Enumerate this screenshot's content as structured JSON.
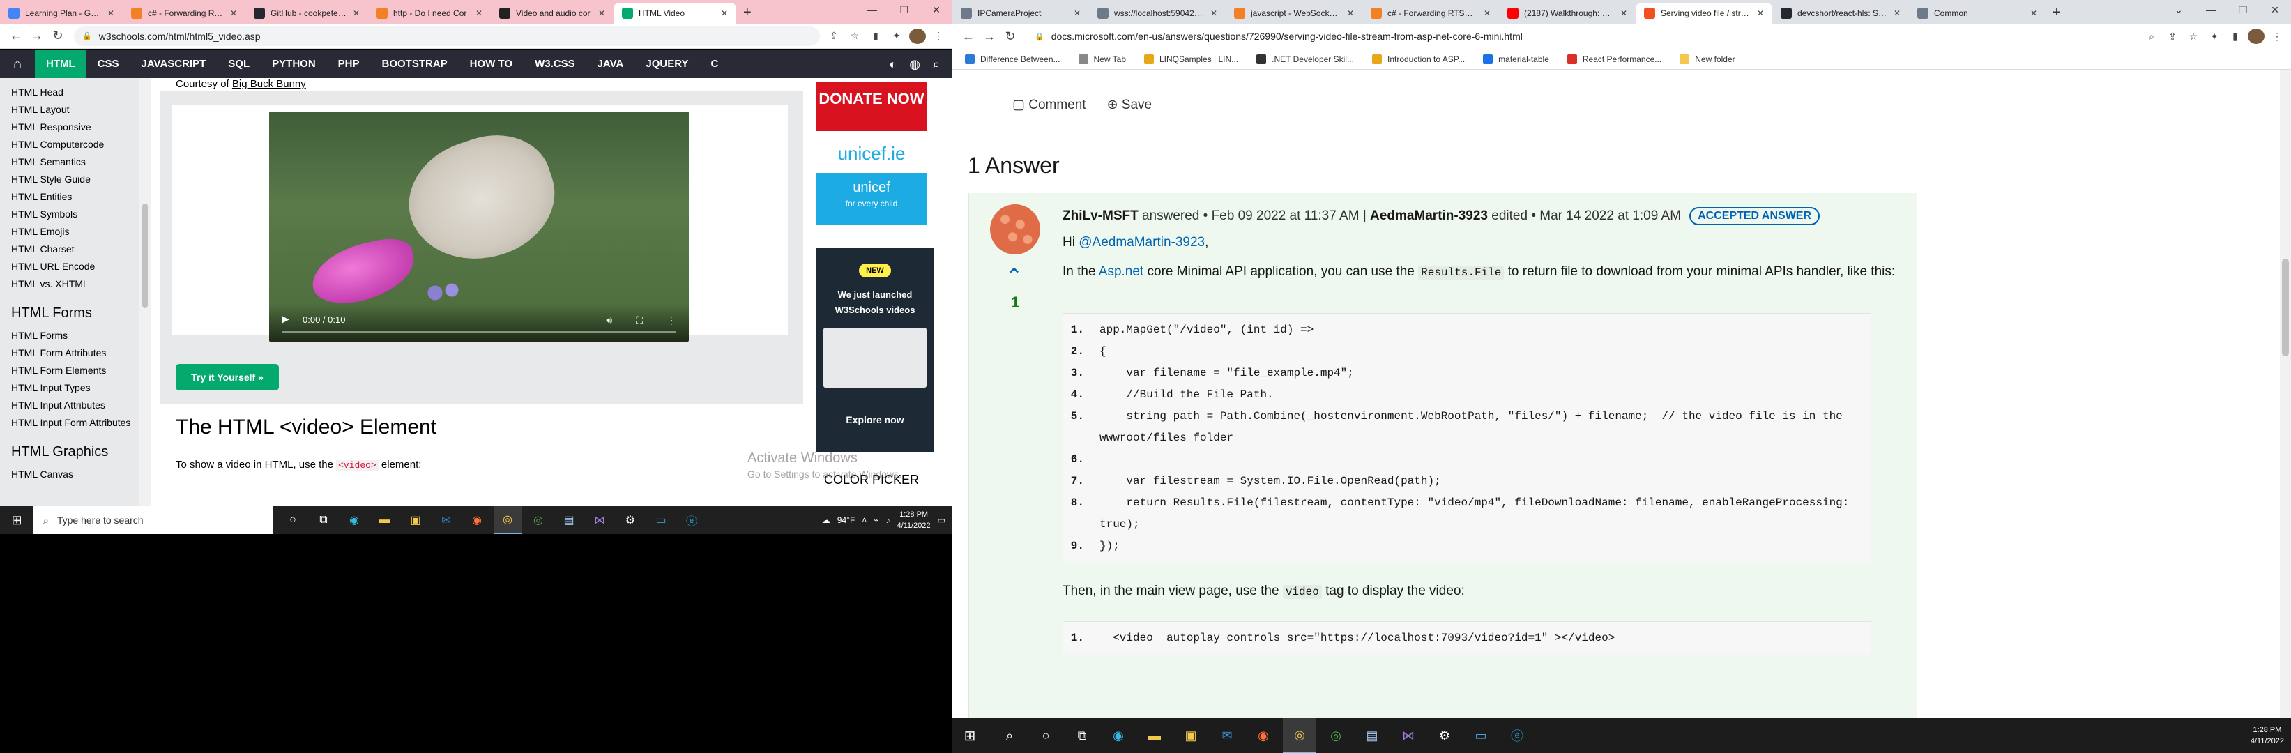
{
  "left": {
    "tabs": [
      {
        "title": "Learning Plan - Goog",
        "color": "#4285f4"
      },
      {
        "title": "c# - Forwarding RTSP",
        "color": "#f48024"
      },
      {
        "title": "GitHub - cookpete/re",
        "color": "#24292f"
      },
      {
        "title": "http - Do I need Cor",
        "color": "#f48024"
      },
      {
        "title": "Video and audio cor",
        "color": "#222222"
      },
      {
        "title": "HTML Video",
        "color": "#04aa6d"
      }
    ],
    "url": "w3schools.com/html/html5_video.asp",
    "nav": {
      "home_icon": "home-icon",
      "items": [
        "HTML",
        "CSS",
        "JAVASCRIPT",
        "SQL",
        "PYTHON",
        "PHP",
        "BOOTSTRAP",
        "HOW TO",
        "W3.CSS",
        "JAVA",
        "JQUERY",
        "C"
      ]
    },
    "sidebar": {
      "links1": [
        "HTML Head",
        "HTML Layout",
        "HTML Responsive",
        "HTML Computercode",
        "HTML Semantics",
        "HTML Style Guide",
        "HTML Entities",
        "HTML Symbols",
        "HTML Emojis",
        "HTML Charset",
        "HTML URL Encode",
        "HTML vs. XHTML"
      ],
      "heading_forms": "HTML Forms",
      "links2": [
        "HTML Forms",
        "HTML Form Attributes",
        "HTML Form Elements",
        "HTML Input Types",
        "HTML Input Attributes",
        "HTML Input Form Attributes"
      ],
      "heading_graphics": "HTML Graphics",
      "links3": [
        "HTML Canvas"
      ]
    },
    "main": {
      "courtesy_prefix": "Courtesy of ",
      "courtesy_link": "Big Buck Bunny",
      "video_time": "0:00 / 0:10",
      "try_button": "Try it Yourself »",
      "heading": "The HTML <video> Element",
      "para_prefix": "To show a video in HTML, use the ",
      "para_code": "<video>",
      "para_suffix": " element:"
    },
    "right": {
      "donate": "DONATE NOW",
      "unicef1": "unicef.ie",
      "unicef2_title": "unicef",
      "unicef2_sub": "for every child",
      "ad_badge": "NEW",
      "ad_text_1": "We just launched",
      "ad_text_2": "W3Schools videos",
      "ad_cta": "Explore now",
      "color_picker": "COLOR PICKER"
    },
    "watermark_title": "Activate Windows",
    "watermark_sub": "Go to Settings to activate Windows.",
    "taskbar": {
      "search_placeholder": "Type here to search",
      "weather": "94°F",
      "time": "1:28 PM",
      "date": "4/11/2022"
    }
  },
  "right": {
    "tabs": [
      {
        "title": "IPCameraProject",
        "color": "#6c7a89"
      },
      {
        "title": "wss://localhost:59042/ws",
        "color": "#6c7a89"
      },
      {
        "title": "javascript - WebSocket co",
        "color": "#f48024"
      },
      {
        "title": "c# - Forwarding RTSP stre",
        "color": "#f48024"
      },
      {
        "title": "(2187) Walkthrough: How",
        "color": "#ff0000"
      },
      {
        "title": "Serving video file / stream",
        "color": "#f25022"
      },
      {
        "title": "devcshort/react-hls: Simpl",
        "color": "#24292f"
      },
      {
        "title": "Common",
        "color": "#6c7a89"
      }
    ],
    "url": "docs.microsoft.com/en-us/answers/questions/726990/serving-video-file-stream-from-asp-net-core-6-mini.html",
    "bookmarks": [
      {
        "label": "Difference Between...",
        "color": "#2b7bd6"
      },
      {
        "label": "New Tab",
        "color": "#888888"
      },
      {
        "label": "LINQSamples | LIN...",
        "color": "#e6a817"
      },
      {
        "label": ".NET Developer Skil...",
        "color": "#333333"
      },
      {
        "label": "Introduction to ASP...",
        "color": "#e6a817"
      },
      {
        "label": "material-table",
        "color": "#1a73e8"
      },
      {
        "label": "React Performance...",
        "color": "#d93025"
      },
      {
        "label": "New folder",
        "color": "#f2c94c"
      }
    ],
    "comment_label": "Comment",
    "save_label": "Save",
    "answers_heading": "1 Answer",
    "answer": {
      "author": "ZhiLv-MSFT",
      "answered_text": " answered • Feb 09 2022 at 11:37 AM | ",
      "editor": "AedmaMartin-3923",
      "edited_text": " edited • Mar 14 2022 at 1:09 AM",
      "accepted": "ACCEPTED ANSWER",
      "votes": "1",
      "greeting_prefix": "Hi ",
      "greeting_mention": "@AedmaMartin-3923",
      "greeting_suffix": ",",
      "p1_a": "In the ",
      "p1_link": "Asp.net",
      "p1_b": " core Minimal API application, you can use the ",
      "p1_code": "Results.File",
      "p1_c": " to return file to download from your minimal APIs handler, like this:",
      "code_lines": [
        {
          "num": "1.",
          "text": "app.MapGet(\"/video\", (int id) =>"
        },
        {
          "num": "2.",
          "text": "{"
        },
        {
          "num": "3.",
          "text": "    var filename = \"file_example.mp4\";"
        },
        {
          "num": "4.",
          "text": "    //Build the File Path."
        },
        {
          "num": "5.",
          "text": "    string path = Path.Combine(_hostenvironment.WebRootPath, \"files/\") + filename;  // the video file is in the wwwroot/files folder"
        },
        {
          "num": "6.",
          "text": ""
        },
        {
          "num": "7.",
          "text": "    var filestream = System.IO.File.OpenRead(path);"
        },
        {
          "num": "8.",
          "text": "    return Results.File(filestream, contentType: \"video/mp4\", fileDownloadName: filename, enableRangeProcessing: true);"
        },
        {
          "num": "9.",
          "text": "});"
        }
      ],
      "p2_a": "Then, in the main view page, use the ",
      "p2_code": "video",
      "p2_b": " tag to display the video:",
      "code2_num": "1.",
      "code2_text": "  <video  autoplay controls src=\"https://localhost:7093/video?id=1\" ></video>"
    },
    "taskbar": {
      "time": "1:28 PM",
      "date": "4/11/2022"
    }
  }
}
